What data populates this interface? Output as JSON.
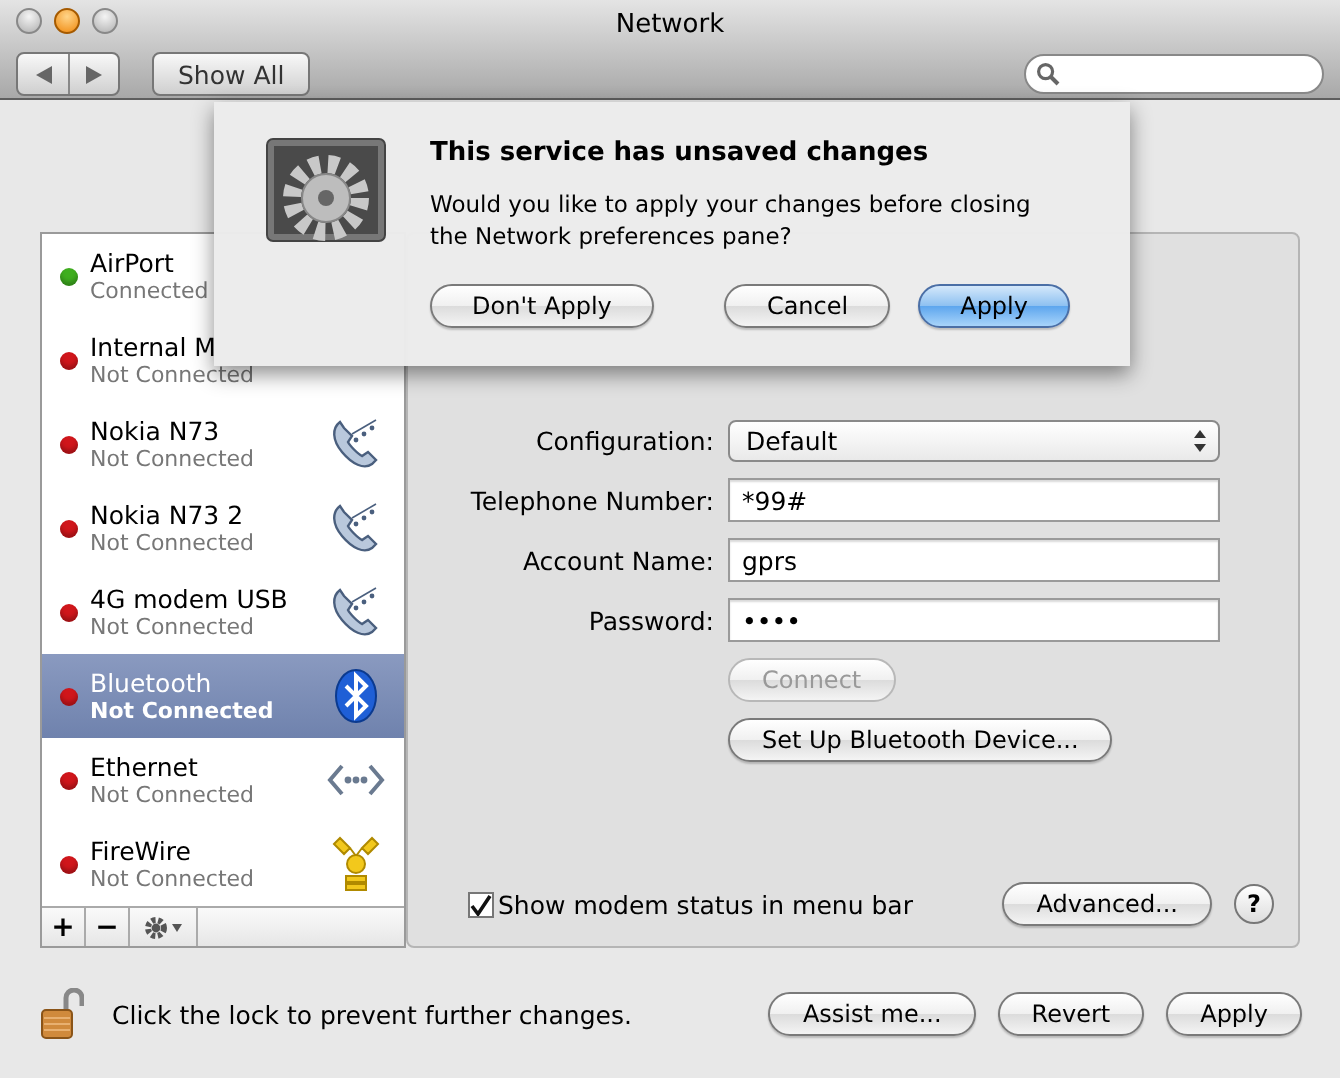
{
  "window": {
    "title": "Network",
    "show_all": "Show All"
  },
  "sheet": {
    "title": "This service has unsaved changes",
    "message": "Would you like to apply your changes before closing the Network preferences pane?",
    "buttons": [
      {
        "label": "Don't Apply",
        "default": false
      },
      {
        "label": "Cancel",
        "default": false
      },
      {
        "label": "Apply",
        "default": true
      }
    ]
  },
  "services": [
    {
      "name": "AirPort",
      "status": "Connected",
      "color": "#3fae1f",
      "selected": false,
      "kind": "none"
    },
    {
      "name": "Internal M",
      "status": "Not Connected",
      "color": "#d0161b",
      "selected": false,
      "kind": "none"
    },
    {
      "name": "Nokia N73",
      "status": "Not Connected",
      "color": "#d0161b",
      "selected": false,
      "kind": "phone"
    },
    {
      "name": "Nokia N73 2",
      "status": "Not Connected",
      "color": "#d0161b",
      "selected": false,
      "kind": "phone"
    },
    {
      "name": "4G modem USB",
      "status": "Not Connected",
      "color": "#d0161b",
      "selected": false,
      "kind": "phone"
    },
    {
      "name": "Bluetooth",
      "status": "Not Connected",
      "color": "#d0161b",
      "selected": true,
      "kind": "bluetooth"
    },
    {
      "name": "Ethernet",
      "status": "Not Connected",
      "color": "#d0161b",
      "selected": false,
      "kind": "ethernet"
    },
    {
      "name": "FireWire",
      "status": "Not Connected",
      "color": "#d0161b",
      "selected": false,
      "kind": "firewire"
    }
  ],
  "list_buttons": [
    "+",
    "−"
  ],
  "form": {
    "configuration": {
      "label": "Configuration:",
      "value": "Default"
    },
    "fields": [
      {
        "label": "Telephone Number:",
        "value": "*99#"
      },
      {
        "label": "Account Name:",
        "value": "gprs"
      },
      {
        "label": "Password:",
        "value": "••••"
      }
    ],
    "connect": {
      "label": "Connect",
      "disabled": true
    },
    "setup": {
      "label": "Set Up Bluetooth Device..."
    },
    "show_status": {
      "label": "Show modem status in menu bar",
      "checked": true
    },
    "advanced": "Advanced...",
    "help": "?"
  },
  "footer": {
    "lock_text": "Click the lock to prevent further changes.",
    "buttons": [
      "Assist me...",
      "Revert",
      "Apply"
    ]
  }
}
